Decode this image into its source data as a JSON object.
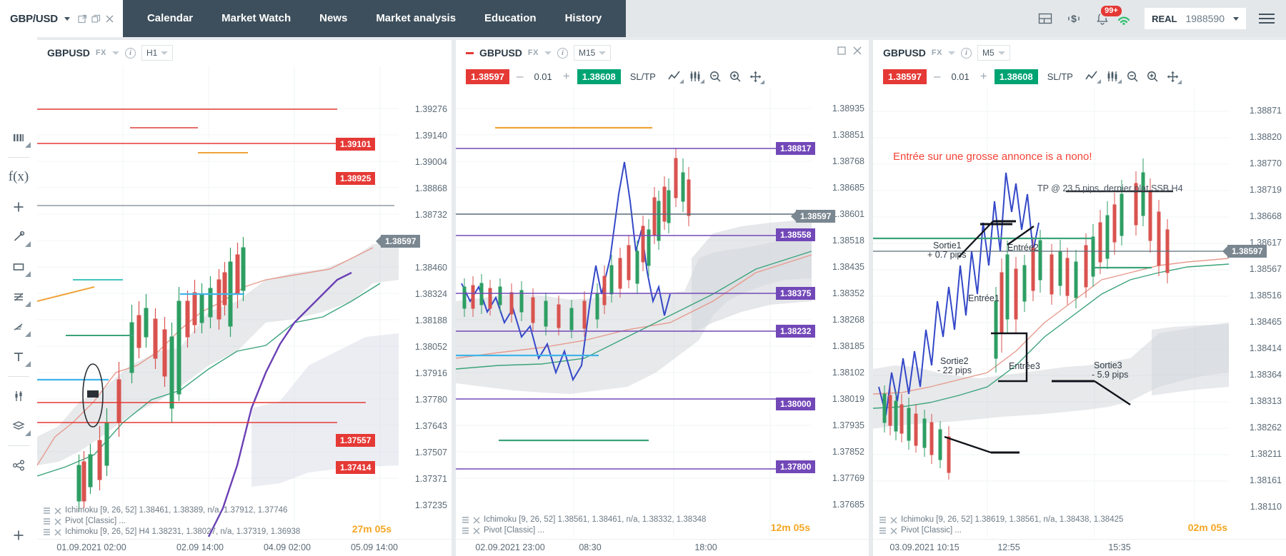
{
  "header": {
    "symbol_tab": {
      "label": "GBP/USD",
      "icons": [
        "popout-icon",
        "restore-icon",
        "close-icon"
      ]
    },
    "nav_items": [
      {
        "label": "Calendar",
        "name": "nav-calendar"
      },
      {
        "label": "Market Watch",
        "name": "nav-market-watch"
      },
      {
        "label": "News",
        "name": "nav-news"
      },
      {
        "label": "Market analysis",
        "name": "nav-market-analysis"
      },
      {
        "label": "Education",
        "name": "nav-education"
      },
      {
        "label": "History",
        "name": "nav-history"
      }
    ],
    "right_icons": [
      "layout-icon",
      "currency-icon",
      "notifications-bell-icon",
      "signal-icon"
    ],
    "notification_count": "99+",
    "account": {
      "type": "REAL",
      "number": "1988590"
    },
    "menu": "hamburger-menu-icon"
  },
  "left_toolbar": {
    "items": [
      {
        "name": "chart-type-icon",
        "label": "Chart type"
      },
      {
        "name": "indicators-fx-icon",
        "label": "f(x)"
      },
      {
        "name": "add-icon",
        "label": "Add"
      },
      {
        "name": "line-tool-icon",
        "label": "Line"
      },
      {
        "name": "rectangle-tool-icon",
        "label": "Rectangle"
      },
      {
        "name": "fibonacci-tool-icon",
        "label": "Fibonacci"
      },
      {
        "name": "brush-tool-icon",
        "label": "Brush"
      },
      {
        "name": "text-tool-icon",
        "label": "Text"
      },
      {
        "name": "candle-settings-icon",
        "label": "Candle settings"
      },
      {
        "name": "layers-icon",
        "label": "Layers"
      },
      {
        "name": "share-icon",
        "label": "Share"
      }
    ],
    "bottom": {
      "name": "add-panel-icon",
      "label": "Add"
    }
  },
  "panels": [
    {
      "id": "panel-h1",
      "symbol": "GBPUSD",
      "market": "FX",
      "timeframe": "H1",
      "has_trade_row": false,
      "window_controls": [],
      "price_ticks": [
        "1.39276",
        "1.39140",
        "1.39004",
        "1.38868",
        "1.38732",
        "1.38597",
        "1.38460",
        "1.38324",
        "1.38188",
        "1.38052",
        "1.37916",
        "1.37780",
        "1.37643",
        "1.37507",
        "1.37371",
        "1.37235"
      ],
      "time_ticks": [
        "01.09.2021 02:00",
        "02.09 14:00",
        "04.09 02:00",
        "05.09 14:00"
      ],
      "level_tags": [
        {
          "value": "1.39101",
          "color": "red"
        },
        {
          "value": "1.38925",
          "color": "red"
        },
        {
          "value": "1.38597",
          "color": "grey"
        },
        {
          "value": "1.37557",
          "color": "red"
        },
        {
          "value": "1.37414",
          "color": "red"
        }
      ],
      "legend": [
        "Ichimoku [9, 26, 52] 1.38461, 1.38389, n/a, 1.37912, 1.37746",
        "Pivot [Classic] ...",
        "Ichimoku [9, 26, 52] H4 1.38231, 1.38027, n/a, 1.37319, 1.36938"
      ],
      "timer": "27m 05s",
      "annotations": []
    },
    {
      "id": "panel-m15",
      "symbol": "GBPUSD",
      "market": "FX",
      "timeframe": "M15",
      "has_trade_row": true,
      "window_controls": [
        "restore-icon",
        "close-icon"
      ],
      "trade": {
        "sell_price": "1.38597",
        "volume": "0.01",
        "buy_price": "1.38608",
        "sltp_label": "SL/TP"
      },
      "trade_icons": [
        "line-chart-icon",
        "candle-chart-icon",
        "zoom-out-icon",
        "zoom-in-icon",
        "crosshair-icon"
      ],
      "price_ticks": [
        "1.38935",
        "1.38851",
        "1.38768",
        "1.38685",
        "1.38601",
        "1.38518",
        "1.38435",
        "1.38352",
        "1.38268",
        "1.38185",
        "1.38102",
        "1.38019",
        "1.37935",
        "1.37852",
        "1.37769",
        "1.37685"
      ],
      "time_ticks": [
        "02.09.2021 23:00",
        "08:30",
        "18:00"
      ],
      "level_tags": [
        {
          "value": "1.38817",
          "color": "purple"
        },
        {
          "value": "1.38597",
          "color": "grey"
        },
        {
          "value": "1.38558",
          "color": "purple"
        },
        {
          "value": "1.38375",
          "color": "purple"
        },
        {
          "value": "1.38232",
          "color": "purple"
        },
        {
          "value": "1.38000",
          "color": "purple"
        },
        {
          "value": "1.37800",
          "color": "purple"
        }
      ],
      "legend": [
        "Ichimoku [9, 26, 52] 1.38561, 1.38461, n/a, 1.38332, 1.38348",
        "Pivot [Classic] ..."
      ],
      "timer": "12m 05s",
      "annotations": []
    },
    {
      "id": "panel-m5",
      "symbol": "GBPUSD",
      "market": "FX",
      "timeframe": "M5",
      "has_trade_row": true,
      "window_controls": [],
      "trade": {
        "sell_price": "1.38597",
        "volume": "0.01",
        "buy_price": "1.38608",
        "sltp_label": "SL/TP"
      },
      "trade_icons": [
        "line-chart-icon",
        "candle-chart-icon",
        "zoom-out-icon",
        "zoom-in-icon",
        "crosshair-icon"
      ],
      "price_ticks": [
        "1.38871",
        "1.38820",
        "1.38770",
        "1.38719",
        "1.38668",
        "1.38617",
        "1.38597",
        "1.38567",
        "1.38516",
        "1.38465",
        "1.38414",
        "1.38364",
        "1.38313",
        "1.38262",
        "1.38211",
        "1.38161",
        "1.38110"
      ],
      "time_ticks": [
        "03.09.2021 10:15",
        "12:55",
        "15:35"
      ],
      "level_tags": [
        {
          "value": "1.38597",
          "color": "grey"
        }
      ],
      "legend": [
        "Ichimoku [9, 26, 52] 1.38619, 1.38561, n/a, 1.38438, 1.38425",
        "Pivot [Classic] ..."
      ],
      "timer": "02m 05s",
      "annotations": [
        {
          "text": "Entrée sur une grosse annonce is a nono!",
          "style": "red"
        },
        {
          "text": "TP @ 23.5 pips, dernier plat SSB H4",
          "style": "dark"
        },
        {
          "text": "Sortie1",
          "style": "label"
        },
        {
          "text": "+ 0.7 pips",
          "style": "label"
        },
        {
          "text": "Entrée2",
          "style": "label"
        },
        {
          "text": "Entrée1",
          "style": "label"
        },
        {
          "text": "Sortie2",
          "style": "label"
        },
        {
          "text": "- 22 pips",
          "style": "label"
        },
        {
          "text": "Entrée3",
          "style": "label"
        },
        {
          "text": "Sortie3",
          "style": "label"
        },
        {
          "text": "- 5.9 pips",
          "style": "label"
        }
      ]
    }
  ],
  "colors": {
    "nav_bg": "#3d4f5c",
    "app_bg": "#e3e7ea",
    "sell_red": "#e53935",
    "buy_green": "#00a472",
    "purple_level": "#7248b8",
    "timer_orange": "#f5a623",
    "annotation_red": "#f44336"
  }
}
